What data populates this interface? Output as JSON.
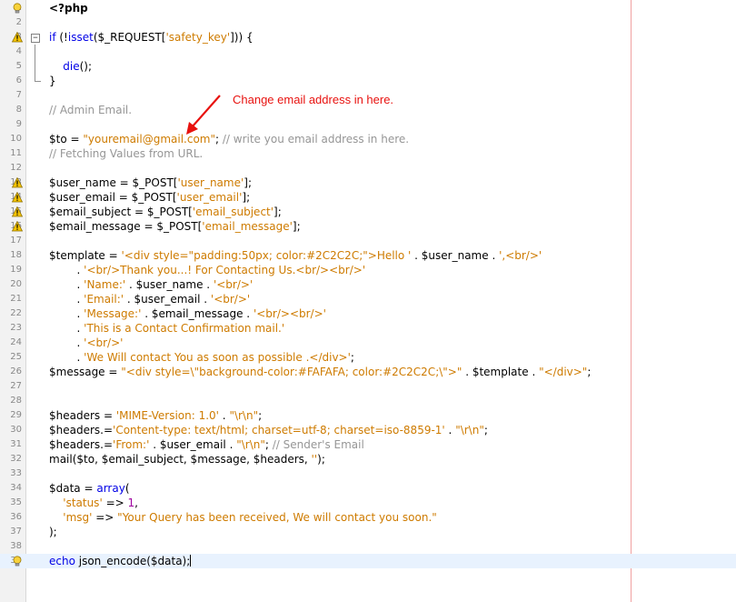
{
  "editor": {
    "annotation": "Change email address in here.",
    "colors": {
      "keyword": "#0000e6",
      "string": "#ce7b00",
      "comment": "#969696",
      "number": "#a000a0",
      "annotation": "#e8120f"
    },
    "lines": [
      {
        "n": "1",
        "glyph": "bulb-icon",
        "t": [
          [
            "b",
            "<?php"
          ]
        ]
      },
      {
        "n": "2",
        "t": []
      },
      {
        "n": "3",
        "glyph": "warning-icon",
        "fold": "start",
        "t": [
          [
            "kw",
            "if"
          ],
          [
            "p",
            " (!"
          ],
          [
            "kw",
            "isset"
          ],
          [
            "p",
            "($_REQUEST["
          ],
          [
            "str",
            "'safety_key'"
          ],
          [
            "p",
            "])) {"
          ]
        ]
      },
      {
        "n": "4",
        "fold": "mid",
        "t": []
      },
      {
        "n": "5",
        "fold": "mid",
        "t": [
          [
            "p",
            "    "
          ],
          [
            "kw",
            "die"
          ],
          [
            "p",
            "();"
          ]
        ]
      },
      {
        "n": "6",
        "fold": "end",
        "t": [
          [
            "p",
            "}"
          ]
        ]
      },
      {
        "n": "7",
        "t": []
      },
      {
        "n": "8",
        "t": [
          [
            "com",
            "// Admin Email."
          ]
        ]
      },
      {
        "n": "9",
        "t": []
      },
      {
        "n": "10",
        "t": [
          [
            "p",
            "$to = "
          ],
          [
            "str",
            "\"youremail@gmail.com\""
          ],
          [
            "p",
            "; "
          ],
          [
            "com",
            "// write you email address in here."
          ]
        ]
      },
      {
        "n": "11",
        "t": [
          [
            "com",
            "// Fetching Values from URL."
          ]
        ]
      },
      {
        "n": "12",
        "t": []
      },
      {
        "n": "13",
        "glyph": "warning-icon",
        "t": [
          [
            "p",
            "$user_name = $_POST["
          ],
          [
            "str",
            "'user_name'"
          ],
          [
            "p",
            "];"
          ]
        ]
      },
      {
        "n": "14",
        "glyph": "warning-icon",
        "t": [
          [
            "p",
            "$user_email = $_POST["
          ],
          [
            "str",
            "'user_email'"
          ],
          [
            "p",
            "];"
          ]
        ]
      },
      {
        "n": "15",
        "glyph": "warning-icon",
        "t": [
          [
            "p",
            "$email_subject = $_POST["
          ],
          [
            "str",
            "'email_subject'"
          ],
          [
            "p",
            "];"
          ]
        ]
      },
      {
        "n": "16",
        "glyph": "warning-icon",
        "t": [
          [
            "p",
            "$email_message = $_POST["
          ],
          [
            "str",
            "'email_message'"
          ],
          [
            "p",
            "];"
          ]
        ]
      },
      {
        "n": "17",
        "t": []
      },
      {
        "n": "18",
        "t": [
          [
            "p",
            "$template = "
          ],
          [
            "str",
            "'<div style=\"padding:50px; color:#2C2C2C;\">Hello '"
          ],
          [
            "p",
            " . $user_name . "
          ],
          [
            "str",
            "',<br/>'"
          ]
        ]
      },
      {
        "n": "19",
        "t": [
          [
            "p",
            "        . "
          ],
          [
            "str",
            "'<br/>Thank you...! For Contacting Us.<br/><br/>'"
          ]
        ]
      },
      {
        "n": "20",
        "t": [
          [
            "p",
            "        . "
          ],
          [
            "str",
            "'Name:'"
          ],
          [
            "p",
            " . $user_name . "
          ],
          [
            "str",
            "'<br/>'"
          ]
        ]
      },
      {
        "n": "21",
        "t": [
          [
            "p",
            "        . "
          ],
          [
            "str",
            "'Email:'"
          ],
          [
            "p",
            " . $user_email . "
          ],
          [
            "str",
            "'<br/>'"
          ]
        ]
      },
      {
        "n": "22",
        "t": [
          [
            "p",
            "        . "
          ],
          [
            "str",
            "'Message:'"
          ],
          [
            "p",
            " . $email_message . "
          ],
          [
            "str",
            "'<br/><br/>'"
          ]
        ]
      },
      {
        "n": "23",
        "t": [
          [
            "p",
            "        . "
          ],
          [
            "str",
            "'This is a Contact Confirmation mail.'"
          ]
        ]
      },
      {
        "n": "24",
        "t": [
          [
            "p",
            "        . "
          ],
          [
            "str",
            "'<br/>'"
          ]
        ]
      },
      {
        "n": "25",
        "t": [
          [
            "p",
            "        . "
          ],
          [
            "str",
            "'We Will contact You as soon as possible .</div>'"
          ],
          [
            "p",
            ";"
          ]
        ]
      },
      {
        "n": "26",
        "t": [
          [
            "p",
            "$message = "
          ],
          [
            "str",
            "\"<div style=\\\"background-color:#FAFAFA; color:#2C2C2C;\\\">\""
          ],
          [
            "p",
            " . $template . "
          ],
          [
            "str",
            "\"</div>\""
          ],
          [
            "p",
            ";"
          ]
        ]
      },
      {
        "n": "27",
        "t": []
      },
      {
        "n": "28",
        "t": []
      },
      {
        "n": "29",
        "t": [
          [
            "p",
            "$headers = "
          ],
          [
            "str",
            "'MIME-Version: 1.0'"
          ],
          [
            "p",
            " . "
          ],
          [
            "str",
            "\"\\r\\n\""
          ],
          [
            "p",
            ";"
          ]
        ]
      },
      {
        "n": "30",
        "t": [
          [
            "p",
            "$headers.="
          ],
          [
            "str",
            "'Content-type: text/html; charset=utf-8; charset=iso-8859-1'"
          ],
          [
            "p",
            " . "
          ],
          [
            "str",
            "\"\\r\\n\""
          ],
          [
            "p",
            ";"
          ]
        ]
      },
      {
        "n": "31",
        "t": [
          [
            "p",
            "$headers.="
          ],
          [
            "str",
            "'From:'"
          ],
          [
            "p",
            " . $user_email . "
          ],
          [
            "str",
            "\"\\r\\n\""
          ],
          [
            "p",
            "; "
          ],
          [
            "com",
            "// Sender's Email"
          ]
        ]
      },
      {
        "n": "32",
        "t": [
          [
            "p",
            "mail($to, $email_subject, $message, $headers, "
          ],
          [
            "str",
            "''"
          ],
          [
            "p",
            ");"
          ]
        ]
      },
      {
        "n": "33",
        "t": []
      },
      {
        "n": "34",
        "t": [
          [
            "p",
            "$data = "
          ],
          [
            "kw",
            "array"
          ],
          [
            "p",
            "("
          ]
        ]
      },
      {
        "n": "35",
        "t": [
          [
            "p",
            "    "
          ],
          [
            "str",
            "'status'"
          ],
          [
            "p",
            " => "
          ],
          [
            "num",
            "1"
          ],
          [
            "p",
            ","
          ]
        ]
      },
      {
        "n": "36",
        "t": [
          [
            "p",
            "    "
          ],
          [
            "str",
            "'msg'"
          ],
          [
            "p",
            " => "
          ],
          [
            "str",
            "\"Your Query has been received, We will contact you soon.\""
          ]
        ]
      },
      {
        "n": "37",
        "t": [
          [
            "p",
            ");"
          ]
        ]
      },
      {
        "n": "38",
        "t": []
      },
      {
        "n": "39",
        "glyph": "bulb-icon",
        "current": true,
        "t": [
          [
            "kw",
            "echo"
          ],
          [
            "p",
            " json_encode($data);"
          ]
        ]
      }
    ]
  }
}
